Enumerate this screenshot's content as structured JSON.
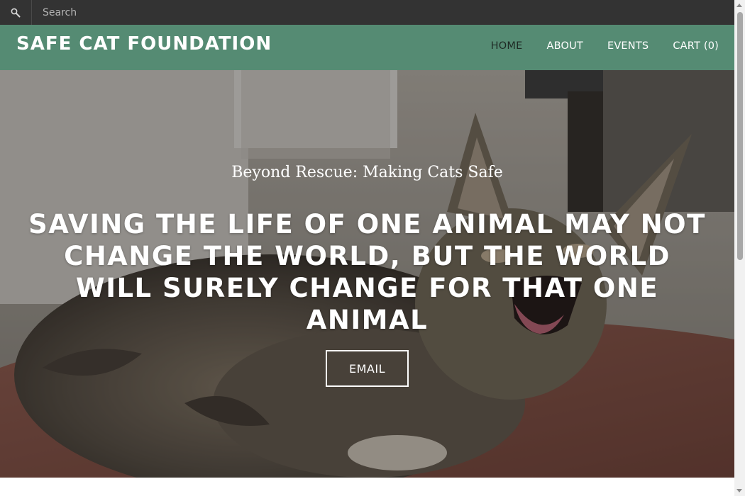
{
  "search": {
    "placeholder": "Search",
    "icon": "search-icon"
  },
  "header": {
    "site_title": "SAFE CAT FOUNDATION",
    "background_color": "#558b73"
  },
  "nav": {
    "items": [
      {
        "label": "HOME",
        "active": true
      },
      {
        "label": "ABOUT",
        "active": false
      },
      {
        "label": "EVENTS",
        "active": false
      }
    ],
    "cart": {
      "label": "CART",
      "count": "(0)"
    }
  },
  "hero": {
    "subtitle": "Beyond Rescue: Making Cats Safe",
    "headline": "SAVING THE LIFE OF ONE ANIMAL MAY NOT CHANGE THE WORLD, BUT THE WORLD WILL SURELY CHANGE FOR THAT ONE ANIMAL",
    "button_label": "EMAIL",
    "image": "cat-photo"
  }
}
